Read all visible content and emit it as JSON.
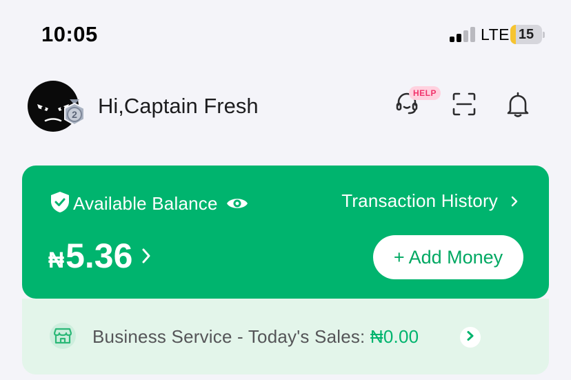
{
  "status_bar": {
    "time": "10:05",
    "network": "LTE",
    "battery_level": "15",
    "icons": [
      "signal-icon",
      "battery-icon"
    ]
  },
  "header": {
    "greeting": "Hi,Captain Fresh",
    "medal_level": "2",
    "help_badge": "HELP",
    "icons": [
      "avatar",
      "medal-icon",
      "support-headset-icon",
      "scan-icon",
      "bell-icon"
    ]
  },
  "balance_card": {
    "label": "Available Balance",
    "currency": "₦",
    "amount": "5.36",
    "history_link": "Transaction History",
    "add_money": "+ Add Money",
    "colors": {
      "card": "#00b46e",
      "button_text": "#00a862"
    },
    "icons": [
      "shield-check-icon",
      "eye-icon",
      "chevron-right-icon"
    ]
  },
  "business": {
    "label": "Business Service - Today's Sales: ",
    "sales": "₦0.00",
    "colors": {
      "panel": "#e3f5ea",
      "accent": "#00b46e"
    },
    "icons": [
      "store-icon",
      "chevron-right-icon"
    ]
  }
}
